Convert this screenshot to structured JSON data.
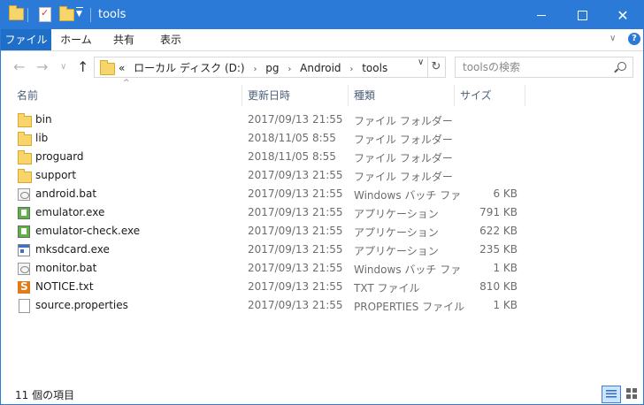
{
  "window": {
    "title": "tools"
  },
  "ribbon": {
    "tabs": [
      {
        "label": "ファイル",
        "active": true
      },
      {
        "label": "ホーム"
      },
      {
        "label": "共有"
      },
      {
        "label": "表示"
      }
    ],
    "help_label": "?"
  },
  "nav": {
    "back_glyph": "←",
    "forward_glyph": "→",
    "recent_glyph": "∨",
    "up_glyph": "↑",
    "address": {
      "overflow": "«",
      "crumbs": [
        "ローカル ディスク (D:)",
        "pg",
        "Android",
        "tools"
      ],
      "separator": "›"
    },
    "refresh_glyph": "↻",
    "search_placeholder": "toolsの検索"
  },
  "columns": {
    "name": "名前",
    "date": "更新日時",
    "type": "種類",
    "size": "サイズ"
  },
  "files": [
    {
      "name": "bin",
      "date": "2017/09/13 21:55",
      "type": "ファイル フォルダー",
      "size": "",
      "icon": "folder-icon"
    },
    {
      "name": "lib",
      "date": "2018/11/05 8:55",
      "type": "ファイル フォルダー",
      "size": "",
      "icon": "folder-icon"
    },
    {
      "name": "proguard",
      "date": "2018/11/05 8:55",
      "type": "ファイル フォルダー",
      "size": "",
      "icon": "folder-icon"
    },
    {
      "name": "support",
      "date": "2017/09/13 21:55",
      "type": "ファイル フォルダー",
      "size": "",
      "icon": "folder-icon"
    },
    {
      "name": "android.bat",
      "date": "2017/09/13 21:55",
      "type": "Windows バッチ ファ",
      "size": "6 KB",
      "icon": "batch-file-icon"
    },
    {
      "name": "emulator.exe",
      "date": "2017/09/13 21:55",
      "type": "アプリケーション",
      "size": "791 KB",
      "icon": "android-exe-icon"
    },
    {
      "name": "emulator-check.exe",
      "date": "2017/09/13 21:55",
      "type": "アプリケーション",
      "size": "622 KB",
      "icon": "android-exe-icon"
    },
    {
      "name": "mksdcard.exe",
      "date": "2017/09/13 21:55",
      "type": "アプリケーション",
      "size": "235 KB",
      "icon": "application-icon"
    },
    {
      "name": "monitor.bat",
      "date": "2017/09/13 21:55",
      "type": "Windows バッチ ファ",
      "size": "1 KB",
      "icon": "batch-file-icon"
    },
    {
      "name": "NOTICE.txt",
      "date": "2017/09/13 21:55",
      "type": "TXT ファイル",
      "size": "810 KB",
      "icon": "sublime-text-icon"
    },
    {
      "name": "source.properties",
      "date": "2017/09/13 21:55",
      "type": "PROPERTIES ファイル",
      "size": "1 KB",
      "icon": "blank-file-icon"
    }
  ],
  "status": {
    "item_count": "11 個の項目"
  },
  "colors": {
    "accent": "#2b7ad8",
    "file_tab": "#1f6fc9",
    "folder": "#f7d56b"
  }
}
